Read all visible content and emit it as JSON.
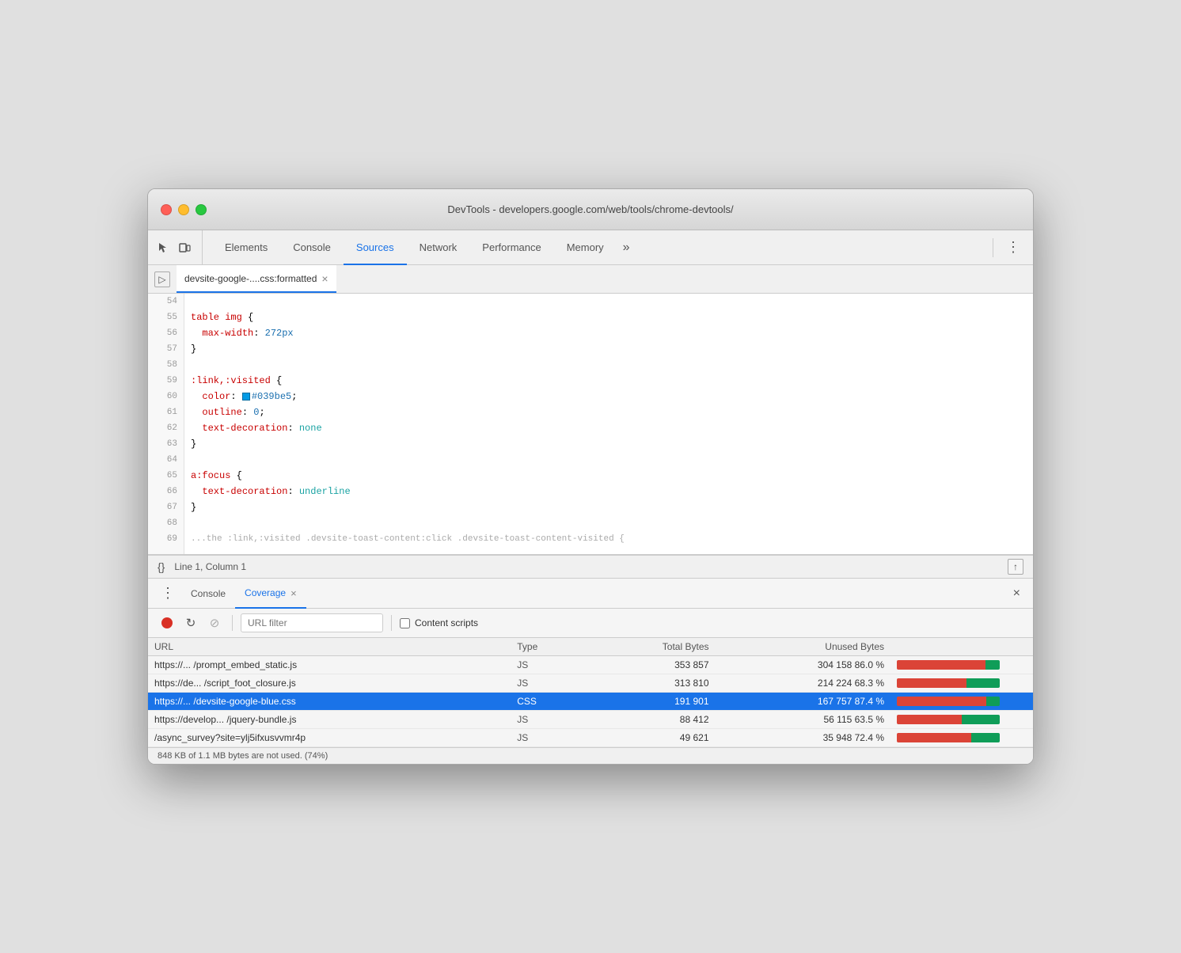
{
  "window": {
    "title": "DevTools - developers.google.com/web/tools/chrome-devtools/"
  },
  "tabs": [
    {
      "id": "elements",
      "label": "Elements",
      "active": false
    },
    {
      "id": "console",
      "label": "Console",
      "active": false
    },
    {
      "id": "sources",
      "label": "Sources",
      "active": true
    },
    {
      "id": "network",
      "label": "Network",
      "active": false
    },
    {
      "id": "performance",
      "label": "Performance",
      "active": false
    },
    {
      "id": "memory",
      "label": "Memory",
      "active": false
    }
  ],
  "tab_more": "»",
  "file_tab": {
    "label": "devsite-google-....css:formatted",
    "close": "×"
  },
  "code_lines": [
    {
      "num": "54",
      "content": ""
    },
    {
      "num": "55",
      "content": "table img {"
    },
    {
      "num": "56",
      "content": "  max-width: 272px"
    },
    {
      "num": "57",
      "content": "}"
    },
    {
      "num": "58",
      "content": ""
    },
    {
      "num": "59",
      "content": ":link,:visited {"
    },
    {
      "num": "60",
      "content": "  color: #039be5;"
    },
    {
      "num": "61",
      "content": "  outline: 0;"
    },
    {
      "num": "62",
      "content": "  text-decoration: none"
    },
    {
      "num": "63",
      "content": "}"
    },
    {
      "num": "64",
      "content": ""
    },
    {
      "num": "65",
      "content": "a:focus {"
    },
    {
      "num": "66",
      "content": "  text-decoration: underline"
    },
    {
      "num": "67",
      "content": "}"
    },
    {
      "num": "68",
      "content": ""
    },
    {
      "num": "69",
      "content": "..."
    }
  ],
  "editor_status": {
    "position": "Line 1, Column 1"
  },
  "bottom_panel": {
    "tabs": [
      {
        "id": "console",
        "label": "Console",
        "closeable": false,
        "active": false
      },
      {
        "id": "coverage",
        "label": "Coverage",
        "closeable": true,
        "active": true
      }
    ]
  },
  "coverage": {
    "url_filter_placeholder": "URL filter",
    "content_scripts_label": "Content scripts",
    "columns": [
      "URL",
      "Type",
      "Total Bytes",
      "Unused Bytes",
      ""
    ],
    "rows": [
      {
        "url": "https://... /prompt_embed_static.js",
        "type": "JS",
        "total_bytes": "353 857",
        "unused_bytes": "304 158",
        "unused_pct": "86.0 %",
        "bar_used_pct": 86,
        "bar_unused_pct": 14,
        "selected": false
      },
      {
        "url": "https://de... /script_foot_closure.js",
        "type": "JS",
        "total_bytes": "313 810",
        "unused_bytes": "214 224",
        "unused_pct": "68.3 %",
        "bar_used_pct": 68,
        "bar_unused_pct": 32,
        "selected": false
      },
      {
        "url": "https://... /devsite-google-blue.css",
        "type": "CSS",
        "total_bytes": "191 901",
        "unused_bytes": "167 757",
        "unused_pct": "87.4 %",
        "bar_used_pct": 87,
        "bar_unused_pct": 13,
        "selected": true
      },
      {
        "url": "https://develop... /jquery-bundle.js",
        "type": "JS",
        "total_bytes": "88 412",
        "unused_bytes": "56 115",
        "unused_pct": "63.5 %",
        "bar_used_pct": 63,
        "bar_unused_pct": 37,
        "selected": false
      },
      {
        "url": "/async_survey?site=ylj5ifxusvvmr4p",
        "type": "JS",
        "total_bytes": "49 621",
        "unused_bytes": "35 948",
        "unused_pct": "72.4 %",
        "bar_used_pct": 72,
        "bar_unused_pct": 28,
        "selected": false
      }
    ],
    "status": "848 KB of 1.1 MB bytes are not used. (74%)"
  },
  "colors": {
    "accent_blue": "#1a73e8",
    "record_red": "#d93025",
    "bar_unused": "#db4437",
    "bar_used": "#0f9d58"
  }
}
